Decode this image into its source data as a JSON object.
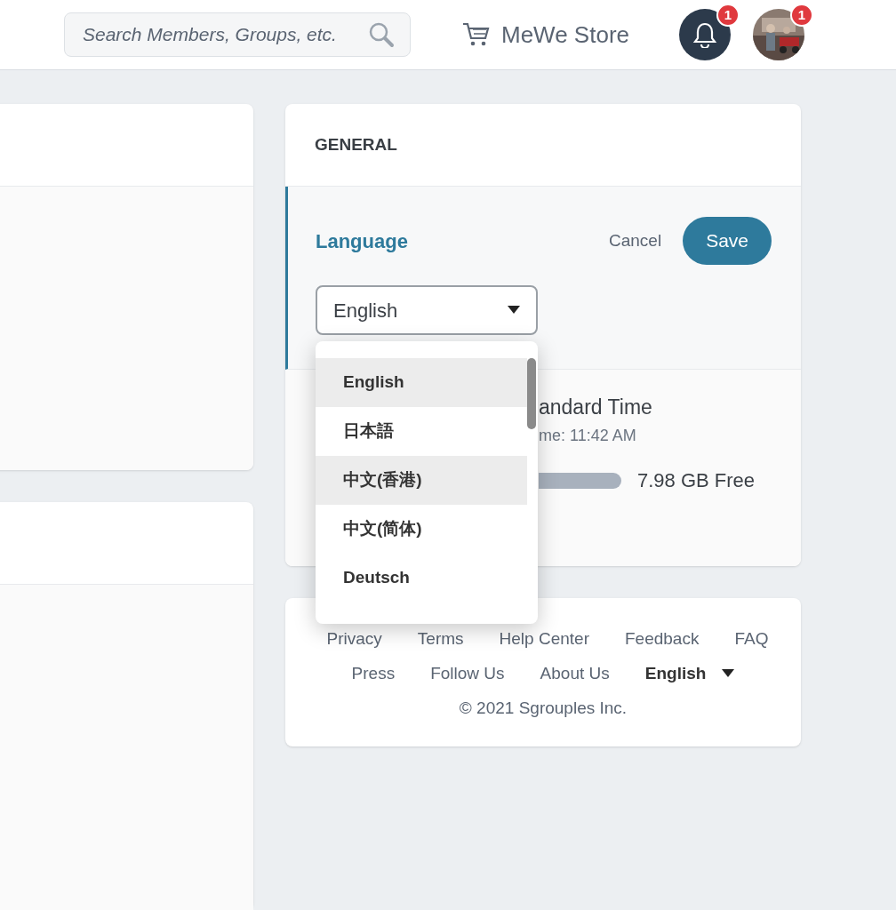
{
  "header": {
    "search": {
      "placeholder": "Search Members, Groups, etc."
    },
    "store_link": "MeWe Store",
    "notifications_badge": "1",
    "avatar_badge": "1"
  },
  "general": {
    "title": "GENERAL",
    "language": {
      "label": "Language",
      "cancel": "Cancel",
      "save": "Save",
      "value": "English",
      "expanded": true,
      "options": [
        {
          "label": "English",
          "highlighted": true
        },
        {
          "label": "日本語",
          "highlighted": false
        },
        {
          "label": "中文(香港)",
          "highlighted": true
        },
        {
          "label": "中文(简体)",
          "highlighted": false
        },
        {
          "label": "Deutsch",
          "highlighted": false
        }
      ]
    },
    "timezone": "andard Time",
    "local_time": "me: 11:42 AM",
    "storage_free": "7.98 GB Free"
  },
  "footer": {
    "links": [
      [
        "Privacy",
        "Terms",
        "Help Center",
        "Feedback",
        "FAQ"
      ],
      [
        "Press",
        "Follow Us",
        "About Us"
      ]
    ],
    "language": "English",
    "copyright": "© 2021 Sgrouples Inc."
  }
}
